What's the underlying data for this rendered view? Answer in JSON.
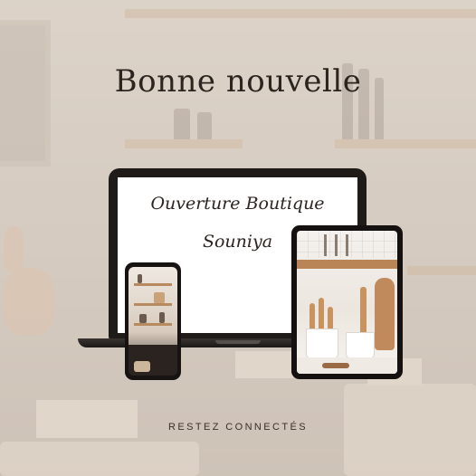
{
  "headline": "Bonne nouvelle",
  "laptop": {
    "line1": "Ouverture Boutique",
    "line2": "Souniya"
  },
  "footer": "RESTEZ CONNECTÉS",
  "colors": {
    "text": "#2c241f",
    "device": "#1f1b19",
    "background": "#d9d0c6"
  }
}
